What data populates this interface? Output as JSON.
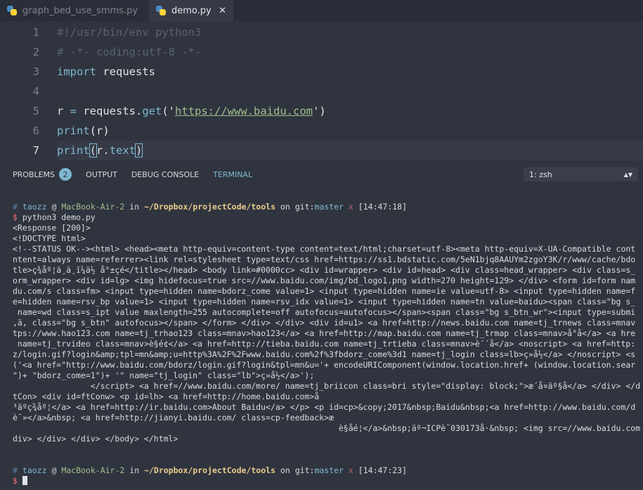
{
  "tabs": [
    {
      "label": "graph_bed_use_smms.py",
      "icon": "python-icon"
    },
    {
      "label": "demo.py",
      "icon": "python-icon",
      "active": true,
      "close": "✕"
    }
  ],
  "editor": {
    "lines": [
      {
        "n": "1",
        "parts": [
          {
            "c": "cm",
            "t": "#!/usr/bin/env python3"
          }
        ]
      },
      {
        "n": "2",
        "parts": [
          {
            "c": "cm",
            "t": "# -*- coding:utf-8 -*-"
          }
        ]
      },
      {
        "n": "3",
        "parts": [
          {
            "c": "kw",
            "t": "import"
          },
          {
            "c": "",
            "t": " requests"
          }
        ]
      },
      {
        "n": "4",
        "parts": []
      },
      {
        "n": "5",
        "parts": [
          {
            "c": "",
            "t": "r "
          },
          {
            "c": "kw",
            "t": "="
          },
          {
            "c": "",
            "t": " requests."
          },
          {
            "c": "fn",
            "t": "get"
          },
          {
            "c": "",
            "t": "('"
          },
          {
            "c": "str",
            "t": "https://www.baidu.com"
          },
          {
            "c": "",
            "t": "')"
          }
        ]
      },
      {
        "n": "6",
        "parts": [
          {
            "c": "fn",
            "t": "print"
          },
          {
            "c": "",
            "t": "(r)"
          }
        ]
      },
      {
        "n": "7",
        "parts": [
          {
            "c": "fn",
            "t": "print"
          },
          {
            "c": "br",
            "t": "("
          },
          {
            "c": "",
            "t": "r."
          },
          {
            "c": "fn",
            "t": "text"
          },
          {
            "c": "br",
            "t": ")"
          }
        ]
      }
    ]
  },
  "panel": {
    "tabs": [
      {
        "label": "PROBLEMS",
        "badge": "2"
      },
      {
        "label": "OUTPUT"
      },
      {
        "label": "DEBUG CONSOLE"
      },
      {
        "label": "TERMINAL",
        "active": true
      }
    ],
    "shell": "1: zsh",
    "shell_arrows": "▲▼"
  },
  "terminal": {
    "prompt1": {
      "hash": "#",
      "user": "taozz",
      "at": "@",
      "host": "MacBook-Air-2",
      "in": "in",
      "path": "~/Dropbox/projectCode/tools",
      "on": "on",
      "git": "git:",
      "branch": "master",
      "dirty": "x",
      "time": "[14:47:18]"
    },
    "command": {
      "dollar": "$",
      "text": "python3 demo.py"
    },
    "output": [
      "<Response [200]>",
      "<!DOCTYPE html>",
      "<!--STATUS OK--><html> <head><meta http-equiv=content-type content=text/html;charset=utf-8><meta http-equiv=X-UA-Compatible cont",
      "ntent=always name=referrer><link rel=stylesheet type=text/css href=https://ss1.bdstatic.com/5eN1bjq8AAUYm2zgoY3K/r/www/cache/bdo",
      "tle>ç¾åº¦ä¸ä¸ï¼ä½ å°±çé</title></head> <body link=#0000cc> <div id=wrapper> <div id=head> <div class=head_wrapper> <div class=s_",
      "orm_wrapper> <div id=lg> <img hidefocus=true src=//www.baidu.com/img/bd_logo1.png width=270 height=129> </div> <form id=form nam",
      "du.com/s class=fm> <input type=hidden name=bdorz_come value=1> <input type=hidden name=ie value=utf-8> <input type=hidden name=f",
      "e=hidden name=rsv_bp value=1> <input type=hidden name=rsv_idx value=1> <input type=hidden name=tn value=baidu><span class=\"bg s_",
      " name=wd class=s_ipt value maxlength=255 autocomplete=off autofocus=autofocus></span><span class=\"bg s_btn_wr\"><input type=submi",
      ",ä, class=\"bg s_btn\" autofocus></span> </form> </div> </div> <div id=u1> <a href=http://news.baidu.com name=tj_trnews class=mnav",
      "tps://www.hao123.com name=tj_trhao123 class=mnav>hao123</a> <a href=http://map.baidu.com name=tj_trmap class=mnav>å°å</a> <a hre",
      " name=tj_trvideo class=mnav>è§é¢</a> <a href=http://tieba.baidu.com name=tj_trtieba class=mnav>è´´å</a> <noscript> <a href=http:",
      "z/login.gif?login&amp;tpl=mn&amp;u=http%3A%2F%2Fwww.baidu.com%2f%3fbdorz_come%3d1 name=tj_login class=lb>ç»å½</a> </noscript> <s",
      "('<a href=\"http://www.baidu.com/bdorz/login.gif?login&tpl=mn&u='+ encodeURIComponent(window.location.href+ (window.location.sear",
      "\")+ \"bdorz_come=1\")+ '\" name=\"tj_login\" class=\"lb\">ç»å½</a>');",
      "                </script> <a href=//www.baidu.com/more/ name=tj_briicon class=bri style=\"display: block;\">æ´å¤äº§å</a> </div> </d",
      "tCon> <div id=ftConw> <p id=lh> <a href=http://home.baidu.com>å",
      "³äºç¾åº¦</a> <a href=http://ir.baidu.com>About Baidu</a> </p> <p id=cp>&copy;2017&nbsp;Baidu&nbsp;<a href=http://www.baidu.com/d",
      "è¯»</a>&nbsp; <a href=http://jianyi.baidu.com/ class=cp-feedback>æ",
      "                                                                   è§åé¦</a>&nbsp;äº¬ICPè¯030173å·&nbsp; <img src=//www.baidu.com",
      "div> </div> </div> </body> </html>",
      "",
      ""
    ],
    "prompt2": {
      "hash": "#",
      "user": "taozz",
      "at": "@",
      "host": "MacBook-Air-2",
      "in": "in",
      "path": "~/Dropbox/projectCode/tools",
      "on": "on",
      "git": "git:",
      "branch": "master",
      "dirty": "x",
      "time": "[14:47:23]"
    },
    "prompt2_dollar": "$"
  }
}
